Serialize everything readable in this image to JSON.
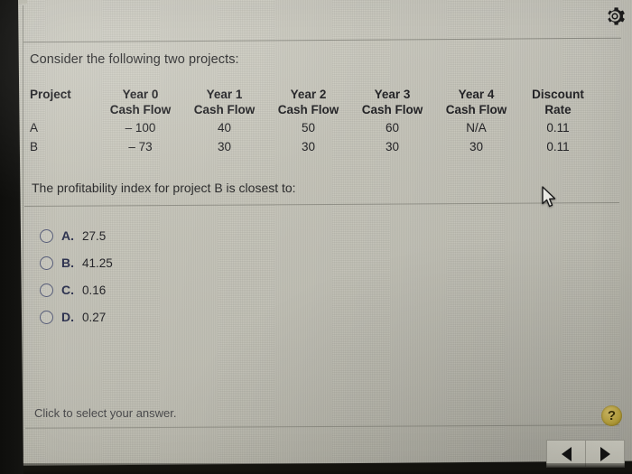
{
  "window": {
    "gear_icon": "gear-icon"
  },
  "prompt": "Consider the following two projects:",
  "table": {
    "headers": [
      {
        "line1": "Project",
        "line2": ""
      },
      {
        "line1": "Year 0",
        "line2": "Cash Flow"
      },
      {
        "line1": "Year 1",
        "line2": "Cash Flow"
      },
      {
        "line1": "Year 2",
        "line2": "Cash Flow"
      },
      {
        "line1": "Year 3",
        "line2": "Cash Flow"
      },
      {
        "line1": "Year 4",
        "line2": "Cash Flow"
      },
      {
        "line1": "Discount",
        "line2": "Rate"
      }
    ],
    "rows": [
      {
        "project": "A",
        "year0": "– 100",
        "year1": "40",
        "year2": "50",
        "year3": "60",
        "year4": "N/A",
        "rate": "0.11"
      },
      {
        "project": "B",
        "year0": "– 73",
        "year1": "30",
        "year2": "30",
        "year3": "30",
        "year4": "30",
        "rate": "0.11"
      }
    ]
  },
  "question": "The profitability index for project B is closest to:",
  "options": [
    {
      "letter": "A.",
      "value": "27.5"
    },
    {
      "letter": "B.",
      "value": "41.25"
    },
    {
      "letter": "C.",
      "value": "0.16"
    },
    {
      "letter": "D.",
      "value": "0.27"
    }
  ],
  "footer": {
    "hint": "Click to select your answer.",
    "help_label": "?",
    "prev_icon": "triangle-left-icon",
    "next_icon": "triangle-right-icon"
  },
  "colors": {
    "screen_background": "#c9c8bd",
    "text": "#2b2b2c",
    "option_letter": "#2e3350",
    "radio_border": "#565c78",
    "help_button": "#bda63f",
    "bezel": "#121210"
  }
}
